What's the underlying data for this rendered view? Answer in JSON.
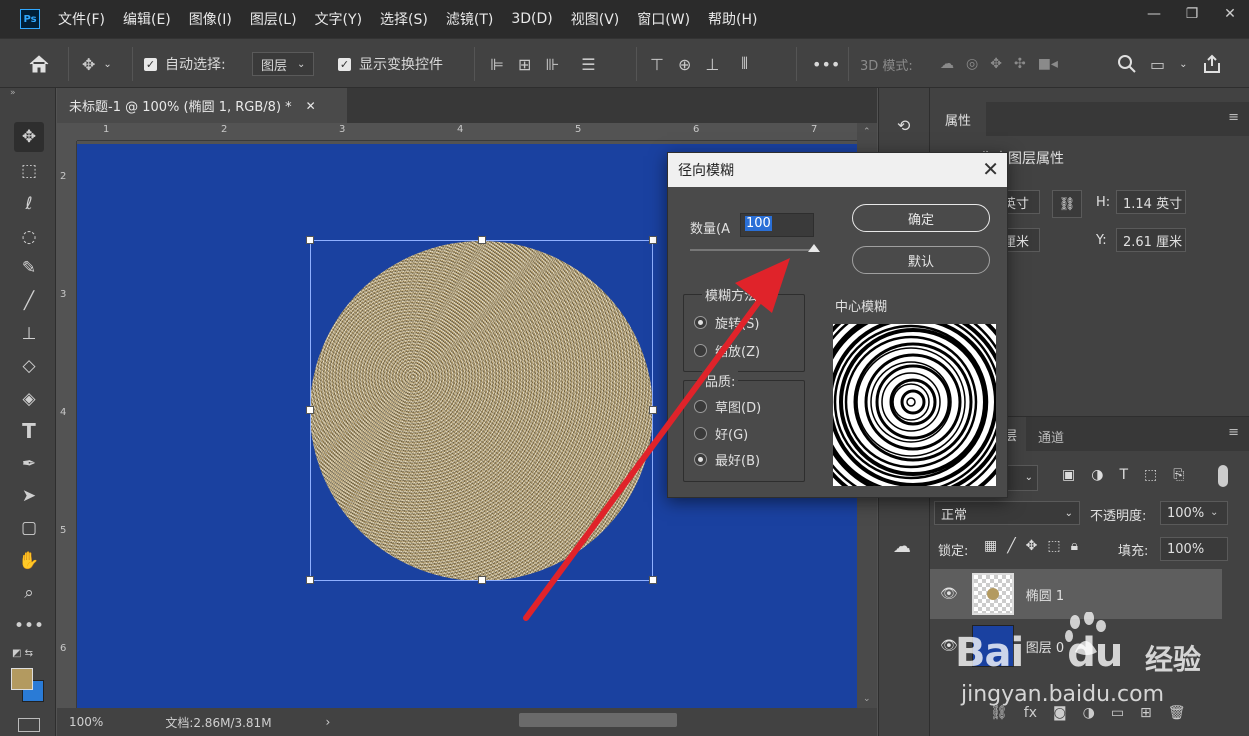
{
  "app": {
    "logo": "Ps"
  },
  "menu": [
    "文件(F)",
    "编辑(E)",
    "图像(I)",
    "图层(L)",
    "文字(Y)",
    "选择(S)",
    "滤镜(T)",
    "3D(D)",
    "视图(V)",
    "窗口(W)",
    "帮助(H)"
  ],
  "window_controls": {
    "minimize": "—",
    "restore": "❐",
    "close": "✕"
  },
  "options_bar": {
    "auto_select_label": "自动选择:",
    "auto_select_value": "图层",
    "show_transform_label": "显示变换控件",
    "mode_3d_label": "3D 模式:",
    "more": "•••"
  },
  "document_tab": {
    "title": "未标题-1 @ 100% (椭圆 1, RGB/8) *",
    "close": "✕"
  },
  "ruler": {
    "h_labels": [
      "1",
      "2",
      "3",
      "4",
      "5",
      "6",
      "7"
    ],
    "v_labels": [
      "2",
      "3",
      "4",
      "5",
      "6"
    ]
  },
  "status_bar": {
    "zoom": "100%",
    "doc_info": "文档:2.86M/3.81M",
    "arrow": "›"
  },
  "properties_panel": {
    "tab": "属性",
    "section_title": "像素图层属性",
    "w_value": "英寸",
    "h_label": "H:",
    "h_value": "1.14 英寸",
    "x_value": "厘米",
    "y_label": "Y:",
    "y_value": "2.61 厘米"
  },
  "layers_panel": {
    "tab_layers": "图层",
    "tab_channels": "通道",
    "blend_mode": "正常",
    "opacity_label": "不透明度:",
    "opacity_value": "100%",
    "lock_label": "锁定:",
    "fill_label": "填充:",
    "fill_value": "100%",
    "layers": [
      {
        "name": "椭圆 1",
        "selected": true
      },
      {
        "name": "图层 0",
        "selected": false
      }
    ]
  },
  "dialog": {
    "title": "径向模糊",
    "amount_label": "数量(A",
    "amount_value": "100",
    "amount_fraction": 1.0,
    "ok_button": "确定",
    "default_button": "默认",
    "method_group": "模糊方法",
    "method_options": [
      "旋转(S)",
      "缩放(Z)"
    ],
    "method_selected": 0,
    "quality_group": "品质:",
    "quality_options": [
      "草图(D)",
      "好(G)",
      "最好(B)"
    ],
    "quality_selected": 2,
    "center_label": "中心模糊"
  },
  "watermark": {
    "brand": "Bai",
    "brand2": "du",
    "cn": "经验",
    "url": "jingyan.baidu.com"
  },
  "colors": {
    "canvas": "#1a41a0",
    "accent": "#e0232a",
    "foreground": "#b39a60",
    "background": "#2a7bd6"
  }
}
